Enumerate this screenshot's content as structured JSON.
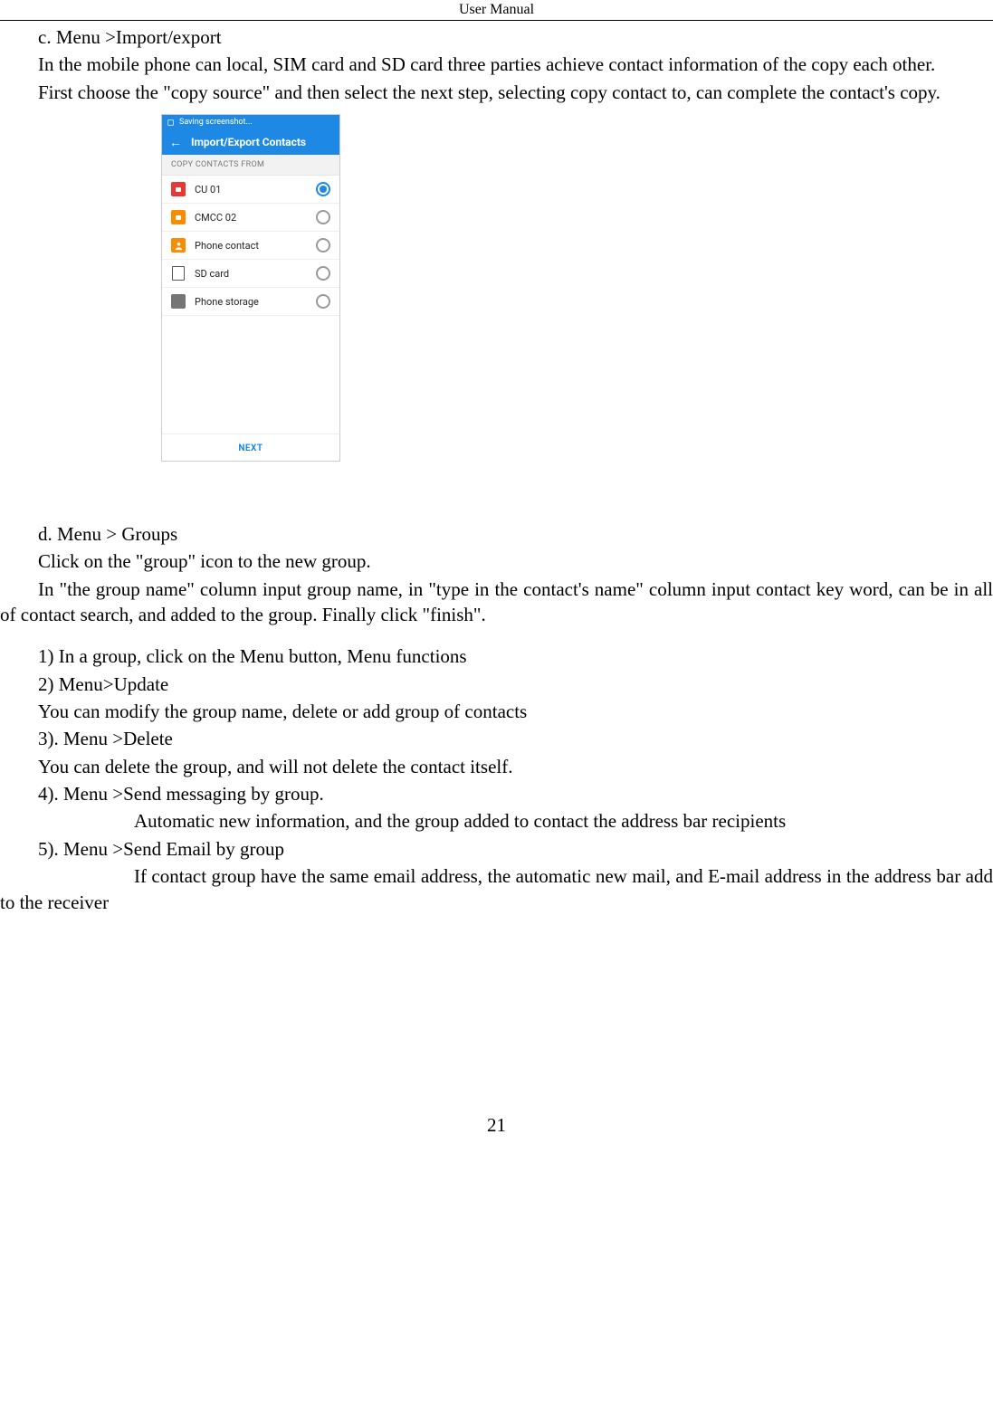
{
  "header": "User    Manual",
  "section_c": {
    "title": "c.   Menu >Import/export",
    "para1": "In the mobile phone can local, SIM card and SD card three parties achieve contact information of the copy each other.",
    "para2": "First choose the \"copy source\" and then select the next step, selecting copy contact to, can complete the contact's copy."
  },
  "phone": {
    "status_text": "Saving screenshot...",
    "appbar_title": "Import/Export Contacts",
    "section_label": "COPY CONTACTS FROM",
    "rows": [
      {
        "label": "CU 01",
        "icon": "sim1",
        "selected": true
      },
      {
        "label": "CMCC 02",
        "icon": "sim2",
        "selected": false
      },
      {
        "label": "Phone contact",
        "icon": "contact",
        "selected": false
      },
      {
        "label": "SD card",
        "icon": "sd",
        "selected": false
      },
      {
        "label": "Phone storage",
        "icon": "storage",
        "selected": false
      }
    ],
    "next_label": "NEXT"
  },
  "section_d": {
    "title": "d.   Menu > Groups",
    "para1": "Click on the \"group\" icon to the new group.",
    "para2": "In \"the group name\" column input group name, in \"type in the contact's name\" column input contact key word, can be in all of contact search, and added to the group. Finally click \"finish\".",
    "items": {
      "i1": "1)    In a group, click on the Menu button,    Menu functions",
      "i2": "2)    Menu>Update",
      "i2b": "You can modify the group name, delete or add group of contacts",
      "i3": "3).    Menu >Delete",
      "i3b": "You can delete the group, and will not delete the contact itself.",
      "i4": "4).    Menu >Send messaging by group.",
      "i4b": "Automatic new information, and the group added to contact the address bar recipients",
      "i5": "5).    Menu >Send Email by group",
      "i5b": "If contact group have the same email address, the automatic new mail, and E-mail address in the address bar add to the receiver"
    }
  },
  "page_number": "21"
}
